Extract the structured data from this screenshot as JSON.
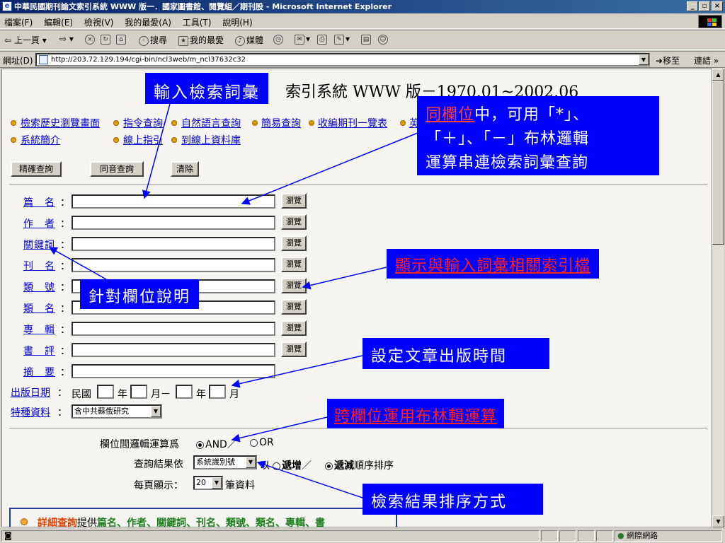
{
  "window": {
    "title": "中華民國期刊論文索引系統 WWW 版一．國家圖書館、閱覽組／期刊股 - Microsoft Internet Explorer",
    "minimize": "_",
    "maximize": "▫",
    "close": "×"
  },
  "menu": [
    "檔案(F)",
    "編輯(E)",
    "檢視(V)",
    "我的最愛(A)",
    "工具(T)",
    "說明(H)"
  ],
  "toolbar": {
    "back": "上一頁",
    "search": "搜尋",
    "favorites": "我的最愛",
    "media": "媒體"
  },
  "address": {
    "label": "網址(D)",
    "url": "http://203.72.129.194/cgi-bin/ncl3web/m_ncl37632c32",
    "go": "移至",
    "links": "連結"
  },
  "page": {
    "title": "索引系統 WWW 版－1970.01~2002.06",
    "nav_row1": [
      "檢索歷史瀏覽畫面",
      "指令查詢",
      "自然語言查詢",
      "簡易查詢",
      "收編期刊一覽表",
      "英"
    ],
    "nav_row2": [
      "系統簡介",
      "線上指引",
      "到線上資料庫"
    ],
    "buttons": {
      "precise": "精確查詢",
      "homophone": "同音查詢",
      "clear": "清除"
    },
    "fields": [
      {
        "label": "篇　名",
        "browse": "瀏覽"
      },
      {
        "label": "作　者",
        "browse": "瀏覽"
      },
      {
        "label": "關鍵詞",
        "browse": "瀏覽"
      },
      {
        "label": "刊　名",
        "browse": "瀏覽"
      },
      {
        "label": "類　號",
        "browse": "瀏覽"
      },
      {
        "label": "類　名",
        "browse": "瀏覽"
      },
      {
        "label": "專　輯",
        "browse": "瀏覽"
      },
      {
        "label": "書　評",
        "browse": "瀏覽"
      },
      {
        "label": "摘　要",
        "browse": ""
      }
    ],
    "colon": "：",
    "pubdate": {
      "label": "出版日期",
      "roc": "民國",
      "year": "年",
      "month": "月",
      "dash": "月－",
      "year2": "年",
      "month2": "月"
    },
    "special": {
      "label": "特種資料",
      "value": "含中共蘇俄研究"
    },
    "logic": {
      "label": "欄位間邏輯運算爲",
      "and": "AND",
      "slash": "／",
      "or": "OR",
      "selected": "AND"
    },
    "sort": {
      "label": "查詢結果依",
      "field": "系統識別號",
      "by": "以",
      "asc": "遞增",
      "sep": "／",
      "desc": "遞減",
      "suffix": "順序排序",
      "selected": "遞減"
    },
    "perpage": {
      "label": "每頁顯示：",
      "value": "20",
      "suffix": "筆資料"
    },
    "info": {
      "title": "詳細查詢",
      "text": "提供",
      "fields": "篇名、作者、關鍵詞、刊名、類號、類名、專輯、書"
    }
  },
  "callouts": {
    "input_terms": "輸入檢索詞彙",
    "same_field_red": "同欄位",
    "same_field_1": "中，可用「*」、",
    "same_field_2": "「＋」、「－」布林邏輯",
    "same_field_3": "運算串連檢索詞彙查詢",
    "related_index": "顯示與輸入詞彙相關索引檔",
    "field_desc": "針對欄位說明",
    "pub_time": "設定文章出版時間",
    "cross_field": "跨欄位運用布林輯運算",
    "sort_method": "檢索結果排序方式"
  },
  "status": {
    "zone": "網際網路"
  }
}
